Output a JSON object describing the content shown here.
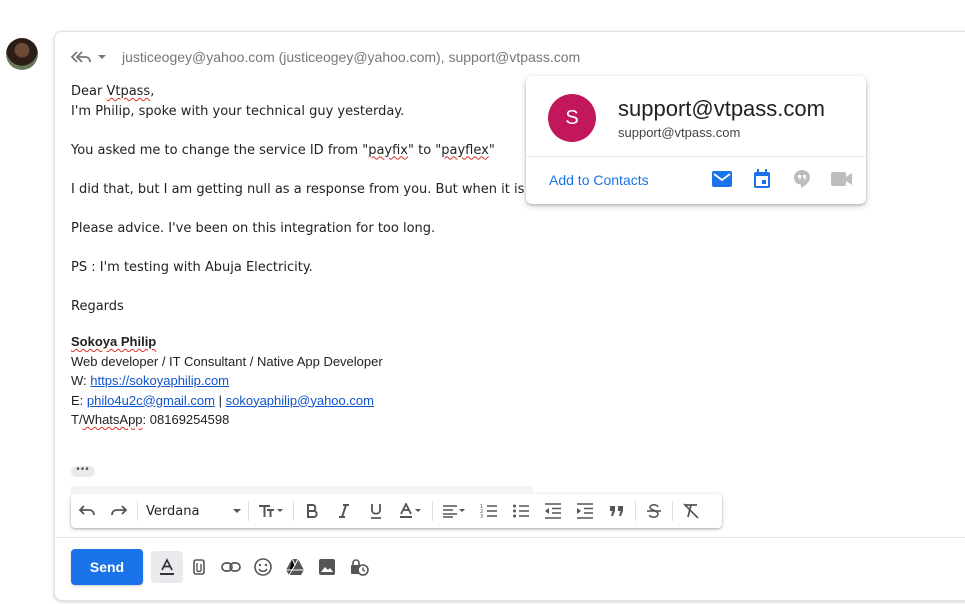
{
  "compose": {
    "recipients": "justiceogey@yahoo.com (justiceogey@yahoo.com), support@vtpass.com",
    "reply_icon": "reply-all-icon",
    "body_lines": [
      "Dear Vtpass,",
      "I'm Philip, spoke with your technical guy yesterday.",
      "",
      "You asked me to change the service ID from \"payfix\" to \"payflex\"",
      "",
      "I did that, but I am getting null as a response from you. But when it is",
      "",
      "Please advice. I've been on this integration for too long.",
      "",
      "PS : I'm testing with Abuja Electricity.",
      "",
      "Regards"
    ],
    "greeting": {
      "prefix": "Dear ",
      "name": "Vtpass",
      "suffix": ","
    },
    "service_line": {
      "a": "You asked me to change the service ID from \"",
      "w1": "payfix",
      "b": "\" to \"",
      "w2": "payflex",
      "c": "\""
    },
    "signature": {
      "name": "Sokoya Philip",
      "title": "Web developer / IT Consultant / Native App Developer",
      "web_label": "W: ",
      "web_url": "https://sokoyaphilip.com",
      "email_label": "E: ",
      "email1": "philo4u2c@gmail.com",
      "email_sep": " | ",
      "email2": "sokoyaphilip@yahoo.com",
      "phone_label_a": "T/",
      "phone_label_b": "WhatsApp",
      "phone": ": 08169254598"
    },
    "more_dots": "•••"
  },
  "format_toolbar": {
    "font": "Verdana",
    "icons": [
      "undo-icon",
      "redo-icon",
      "text-size-icon",
      "bold-icon",
      "italic-icon",
      "underline-icon",
      "text-color-icon",
      "align-icon",
      "numbered-list-icon",
      "bulleted-list-icon",
      "indent-less-icon",
      "indent-more-icon",
      "quote-icon",
      "strikethrough-icon",
      "clear-formatting-icon"
    ]
  },
  "send": {
    "label": "Send"
  },
  "bottom_tools": [
    "formatting-options-icon",
    "attach-icon",
    "link-icon",
    "emoji-icon",
    "drive-icon",
    "photo-icon",
    "confidential-mode-icon"
  ],
  "hovercard": {
    "initial": "S",
    "name": "support@vtpass.com",
    "email": "support@vtpass.com",
    "add_to_contacts": "Add to Contacts",
    "avatar_color": "#c2185b",
    "accent": "#1a73e8"
  }
}
